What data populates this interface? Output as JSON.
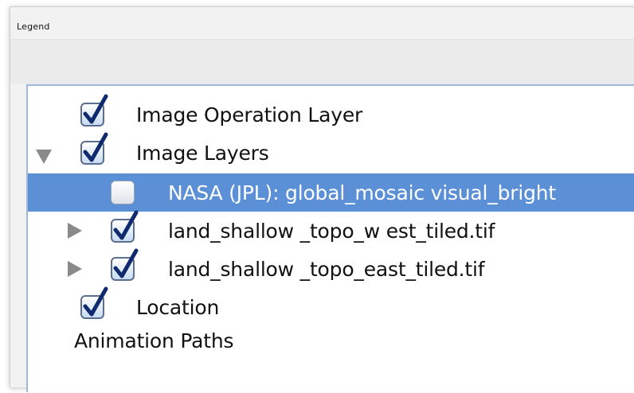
{
  "panel": {
    "title": "Legend"
  },
  "tree": {
    "items": [
      {
        "label": "Image Operation Layer",
        "checked": true,
        "expander": "none",
        "selected": false
      },
      {
        "label": "Image Layers",
        "checked": true,
        "expander": "expanded",
        "selected": false
      },
      {
        "label": "NASA (JPL): global_mosaic visual_bright",
        "checked": false,
        "expander": "none",
        "selected": true
      },
      {
        "label": "land_shallow _topo_w est_tiled.tif",
        "checked": true,
        "expander": "collapsed",
        "selected": false
      },
      {
        "label": "land_shallow _topo_east_tiled.tif",
        "checked": true,
        "expander": "collapsed",
        "selected": false
      },
      {
        "label": "Location",
        "checked": true,
        "expander": "none",
        "selected": false
      },
      {
        "label": "Animation Paths",
        "checked": null,
        "expander": "none",
        "selected": false
      }
    ]
  },
  "colors": {
    "selection": "#5b8fd6",
    "checkmark": "#0f2b6e",
    "expander": "#8a8a8a"
  }
}
